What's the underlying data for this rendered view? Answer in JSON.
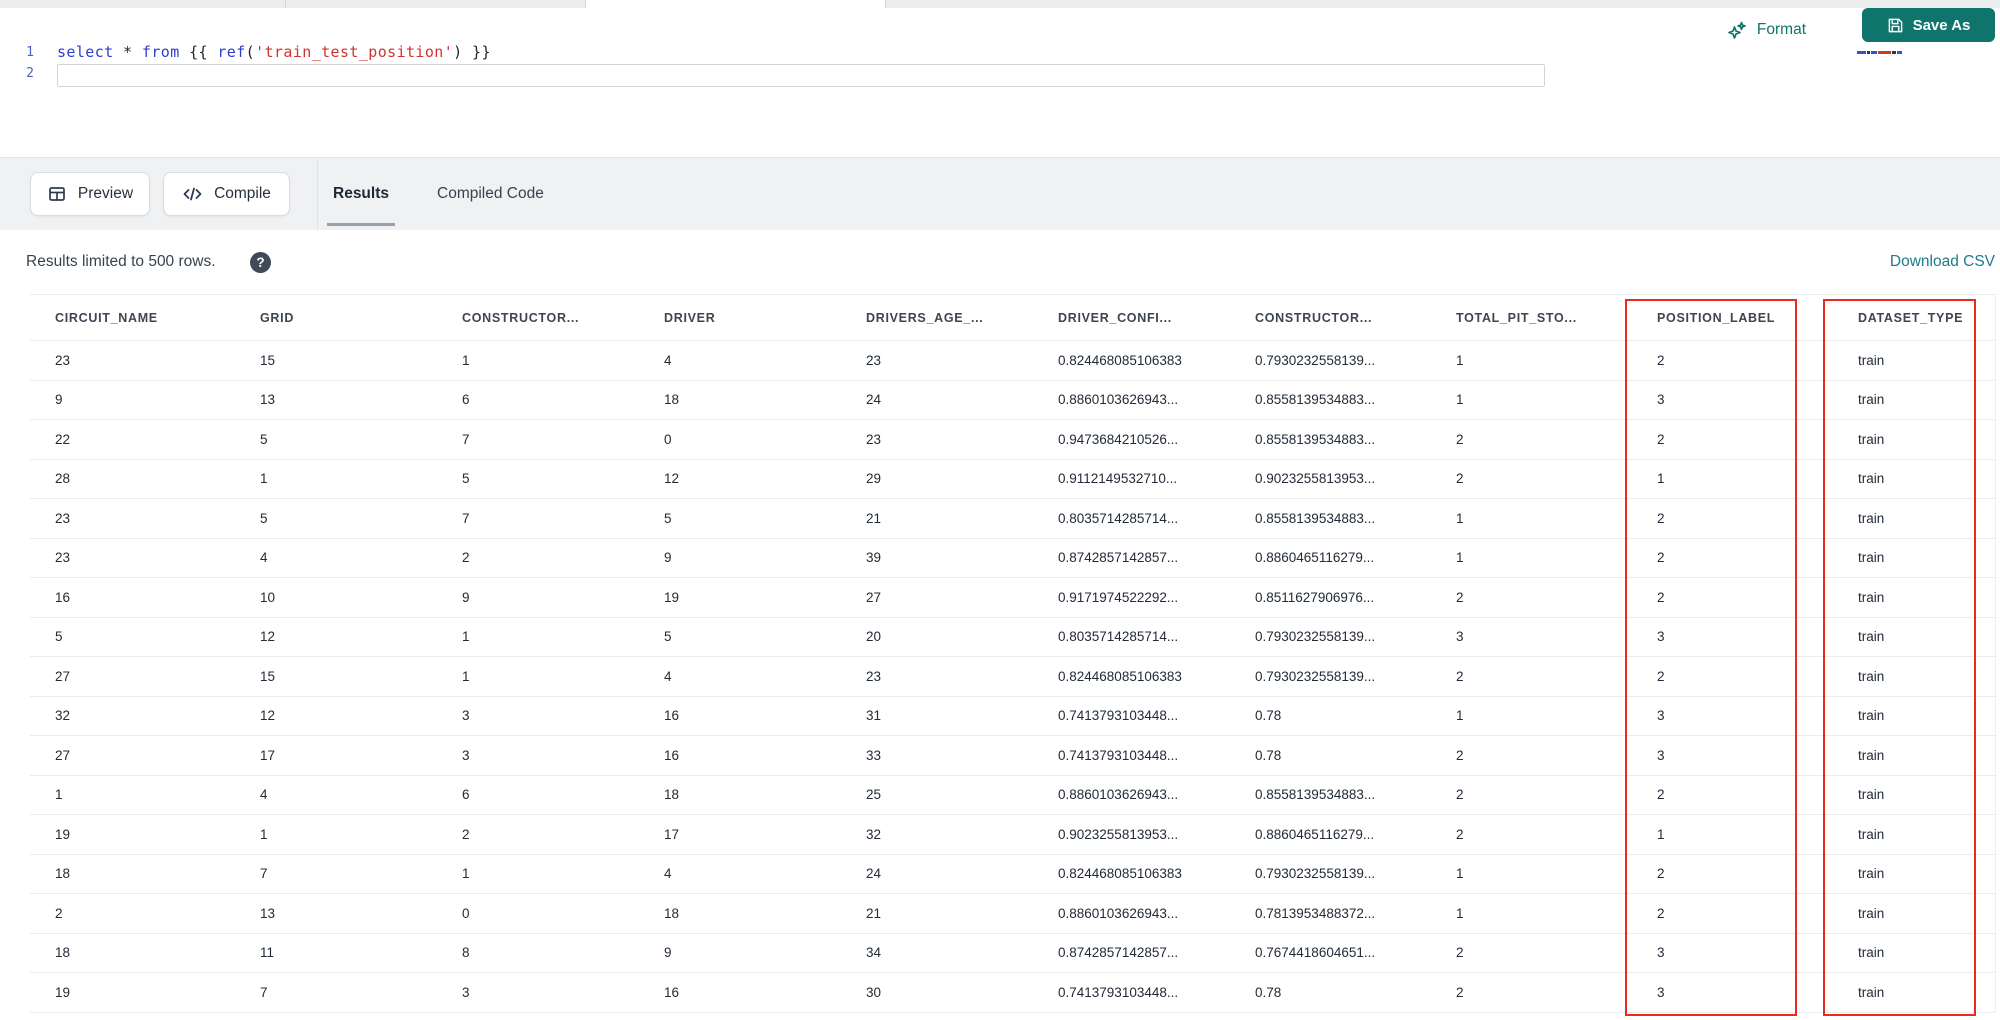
{
  "colors": {
    "teal": "#0f746b",
    "link_teal": "#1e7a8c",
    "highlight_red": "#ea2a1f",
    "keyword_blue": "#2b3ed2",
    "string_red": "#cf342e"
  },
  "editor_header": {
    "format_label": "Format",
    "save_as_label": "Save As"
  },
  "editor": {
    "lines": [
      {
        "number": "1",
        "tokens": [
          {
            "t": "select",
            "c": "kw"
          },
          {
            "t": " ",
            "c": "pl"
          },
          {
            "t": "*",
            "c": "pl"
          },
          {
            "t": " ",
            "c": "pl"
          },
          {
            "t": "from",
            "c": "kw"
          },
          {
            "t": " {{ ",
            "c": "pl"
          },
          {
            "t": "ref",
            "c": "kw"
          },
          {
            "t": "(",
            "c": "pl"
          },
          {
            "t": "'train_test_position'",
            "c": "str"
          },
          {
            "t": ")",
            "c": "pl"
          },
          {
            "t": " }}",
            "c": "pl"
          }
        ]
      },
      {
        "number": "2",
        "tokens": []
      }
    ]
  },
  "panel": {
    "preview_label": "Preview",
    "compile_label": "Compile",
    "tabs": [
      {
        "label": "Results",
        "active": true
      },
      {
        "label": "Compiled Code",
        "active": false
      }
    ]
  },
  "results": {
    "limit_note": "Results limited to 500 rows.",
    "help_glyph": "?",
    "download_label": "Download CSV",
    "columns": [
      "CIRCUIT_NAME",
      "GRID",
      "CONSTRUCTOR...",
      "DRIVER",
      "DRIVERS_AGE_...",
      "DRIVER_CONFI...",
      "CONSTRUCTOR...",
      "TOTAL_PIT_STO...",
      "POSITION_LABEL",
      "DATASET_TYPE"
    ],
    "highlighted_columns": [
      "POSITION_LABEL",
      "DATASET_TYPE"
    ],
    "rows": [
      [
        "23",
        "15",
        "1",
        "4",
        "23",
        "0.824468085106383",
        "0.7930232558139...",
        "1",
        "2",
        "train"
      ],
      [
        "9",
        "13",
        "6",
        "18",
        "24",
        "0.8860103626943...",
        "0.8558139534883...",
        "1",
        "3",
        "train"
      ],
      [
        "22",
        "5",
        "7",
        "0",
        "23",
        "0.9473684210526...",
        "0.8558139534883...",
        "2",
        "2",
        "train"
      ],
      [
        "28",
        "1",
        "5",
        "12",
        "29",
        "0.9112149532710...",
        "0.9023255813953...",
        "2",
        "1",
        "train"
      ],
      [
        "23",
        "5",
        "7",
        "5",
        "21",
        "0.8035714285714...",
        "0.8558139534883...",
        "1",
        "2",
        "train"
      ],
      [
        "23",
        "4",
        "2",
        "9",
        "39",
        "0.8742857142857...",
        "0.8860465116279...",
        "1",
        "2",
        "train"
      ],
      [
        "16",
        "10",
        "9",
        "19",
        "27",
        "0.9171974522292...",
        "0.8511627906976...",
        "2",
        "2",
        "train"
      ],
      [
        "5",
        "12",
        "1",
        "5",
        "20",
        "0.8035714285714...",
        "0.7930232558139...",
        "3",
        "3",
        "train"
      ],
      [
        "27",
        "15",
        "1",
        "4",
        "23",
        "0.824468085106383",
        "0.7930232558139...",
        "2",
        "2",
        "train"
      ],
      [
        "32",
        "12",
        "3",
        "16",
        "31",
        "0.7413793103448...",
        "0.78",
        "1",
        "3",
        "train"
      ],
      [
        "27",
        "17",
        "3",
        "16",
        "33",
        "0.7413793103448...",
        "0.78",
        "2",
        "3",
        "train"
      ],
      [
        "1",
        "4",
        "6",
        "18",
        "25",
        "0.8860103626943...",
        "0.8558139534883...",
        "2",
        "2",
        "train"
      ],
      [
        "19",
        "1",
        "2",
        "17",
        "32",
        "0.9023255813953...",
        "0.8860465116279...",
        "2",
        "1",
        "train"
      ],
      [
        "18",
        "7",
        "1",
        "4",
        "24",
        "0.824468085106383",
        "0.7930232558139...",
        "1",
        "2",
        "train"
      ],
      [
        "2",
        "13",
        "0",
        "18",
        "21",
        "0.8860103626943...",
        "0.7813953488372...",
        "1",
        "2",
        "train"
      ],
      [
        "18",
        "11",
        "8",
        "9",
        "34",
        "0.8742857142857...",
        "0.7674418604651...",
        "2",
        "3",
        "train"
      ],
      [
        "19",
        "7",
        "3",
        "16",
        "30",
        "0.7413793103448...",
        "0.78",
        "2",
        "3",
        "train"
      ]
    ]
  }
}
